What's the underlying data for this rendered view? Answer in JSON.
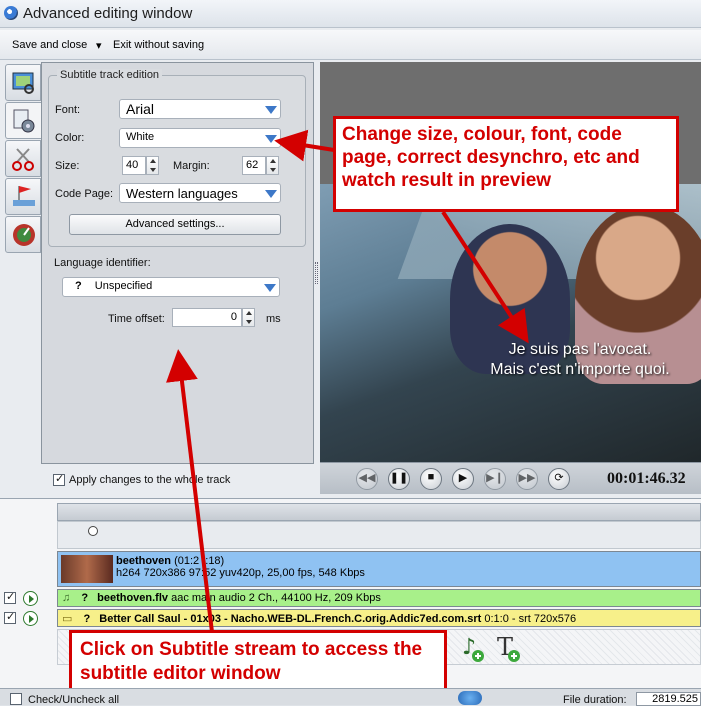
{
  "window": {
    "title": "Advanced editing window"
  },
  "menu": {
    "save_close": "Save and close",
    "exit": "Exit without saving"
  },
  "subtitle_track": {
    "legend": "Subtitle track edition",
    "font_label": "Font:",
    "font_value": "Arial",
    "color_label": "Color:",
    "color_value": "White",
    "size_label": "Size:",
    "size_value": "40",
    "margin_label": "Margin:",
    "margin_value": "62",
    "codepage_label": "Code Page:",
    "codepage_value": "Western languages",
    "advanced_button": "Advanced settings...",
    "language_label": "Language identifier:",
    "language_mark": "?",
    "language_value": "Unspecified",
    "time_offset_label": "Time offset:",
    "time_offset_value": "0",
    "time_offset_unit": "ms",
    "apply_label": "Apply changes to the whole track",
    "apply_checked": true
  },
  "preview": {
    "subtitle_line1": "Je suis pas l'avocat.",
    "subtitle_line2": "Mais c'est n'importe quoi.",
    "timecode": "00:01:46.32"
  },
  "callouts": {
    "top": "Change size, colour, font, code page, correct desynchro, etc and watch result in preview",
    "bottom": "Click on Subtitle stream to access the subtitle editor window"
  },
  "streams": {
    "video_name": "beethoven",
    "video_duration": "(01:2  :18)",
    "video_info": "h264 720x386 97:52 yuv420p, 25,00 fps, 548 Kbps",
    "audio_mark": "?",
    "audio_name": "beethoven.flv",
    "audio_info": "aac main audio 2 Ch., 44100 Hz, 209 Kbps",
    "sub_mark": "?",
    "sub_name": "Better Call Saul - 01x03 - Nacho.WEB-DL.French.C.orig.Addic7ed.com.srt",
    "sub_info": "0:1:0 - srt 720x576"
  },
  "bottom": {
    "check_uncheck": "Check/Uncheck all",
    "file_duration_label": "File duration:",
    "file_duration_value": "2819.525"
  },
  "colors": {
    "callout_red": "#d30000",
    "video_stream": "#8fc2f2",
    "audio_stream": "#a8f08a",
    "subtitle_stream": "#f7f08a"
  }
}
